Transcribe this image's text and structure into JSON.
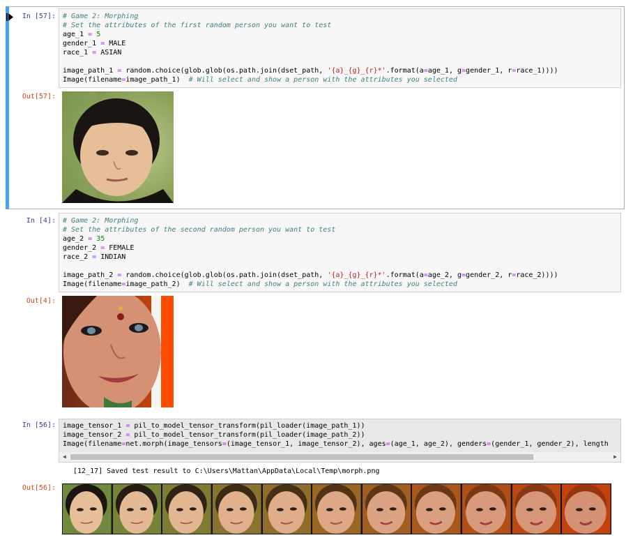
{
  "cells": [
    {
      "in_prompt": "In [57]:",
      "out_prompt": "Out[57]:",
      "code_lines": [
        [
          {
            "t": "# Game 2: Morphing",
            "c": "cm"
          }
        ],
        [
          {
            "t": "# Set the attributes of the first random person you want to test",
            "c": "cm"
          }
        ],
        [
          {
            "t": "age_1 "
          },
          {
            "t": "=",
            "c": "op"
          },
          {
            "t": " "
          },
          {
            "t": "5",
            "c": "nm"
          }
        ],
        [
          {
            "t": "gender_1 "
          },
          {
            "t": "=",
            "c": "op"
          },
          {
            "t": " MALE"
          }
        ],
        [
          {
            "t": "race_1 "
          },
          {
            "t": "=",
            "c": "op"
          },
          {
            "t": " ASIAN"
          }
        ],
        [
          {
            "t": ""
          }
        ],
        [
          {
            "t": "image_path_1 "
          },
          {
            "t": "=",
            "c": "op"
          },
          {
            "t": " random.choice(glob.glob(os.path.join(dset_path, "
          },
          {
            "t": "'{a}_{g}_{r}*'",
            "c": "st"
          },
          {
            "t": ".format(a"
          },
          {
            "t": "=",
            "c": "op"
          },
          {
            "t": "age_1, g"
          },
          {
            "t": "=",
            "c": "op"
          },
          {
            "t": "gender_1, r"
          },
          {
            "t": "=",
            "c": "op"
          },
          {
            "t": "race_1))))"
          }
        ],
        [
          {
            "t": "Image(filename"
          },
          {
            "t": "=",
            "c": "op"
          },
          {
            "t": "image_path_1)  "
          },
          {
            "t": "# Will select and show a person with the attributes you selected",
            "c": "cm"
          }
        ]
      ],
      "image_desc": "child-face"
    },
    {
      "in_prompt": "In [4]:",
      "out_prompt": "Out[4]:",
      "code_lines": [
        [
          {
            "t": "# Game 2: Morphing",
            "c": "cm"
          }
        ],
        [
          {
            "t": "# Set the attributes of the second random person you want to test",
            "c": "cm"
          }
        ],
        [
          {
            "t": "age_2 "
          },
          {
            "t": "=",
            "c": "op"
          },
          {
            "t": " "
          },
          {
            "t": "35",
            "c": "nm"
          }
        ],
        [
          {
            "t": "gender_2 "
          },
          {
            "t": "=",
            "c": "op"
          },
          {
            "t": " FEMALE"
          }
        ],
        [
          {
            "t": "race_2 "
          },
          {
            "t": "=",
            "c": "op"
          },
          {
            "t": " INDIAN"
          }
        ],
        [
          {
            "t": ""
          }
        ],
        [
          {
            "t": "image_path_2 "
          },
          {
            "t": "=",
            "c": "op"
          },
          {
            "t": " random.choice(glob.glob(os.path.join(dset_path, "
          },
          {
            "t": "'{a}_{g}_{r}*'",
            "c": "st"
          },
          {
            "t": ".format(a"
          },
          {
            "t": "=",
            "c": "op"
          },
          {
            "t": "age_2, g"
          },
          {
            "t": "=",
            "c": "op"
          },
          {
            "t": "gender_2, r"
          },
          {
            "t": "=",
            "c": "op"
          },
          {
            "t": "race_2))))"
          }
        ],
        [
          {
            "t": "Image(filename"
          },
          {
            "t": "=",
            "c": "op"
          },
          {
            "t": "image_path_2)  "
          },
          {
            "t": "# Will select and show a person with the attributes you selected",
            "c": "cm"
          }
        ]
      ],
      "image_desc": "woman-face"
    },
    {
      "in_prompt": "In [56]:",
      "out_prompt": "Out[56]:",
      "code_lines": [
        [
          {
            "t": "image_tensor_1 "
          },
          {
            "t": "=",
            "c": "op"
          },
          {
            "t": " pil_to_model_tensor_transform(pil_loader(image_path_1))"
          }
        ],
        [
          {
            "t": "image_tensor_2 "
          },
          {
            "t": "=",
            "c": "op"
          },
          {
            "t": " pil_to_model_tensor_transform(pil_loader(image_path_2))"
          }
        ],
        [
          {
            "t": "Image(filename"
          },
          {
            "t": "=",
            "c": "op"
          },
          {
            "t": "net.morph(image_tensors"
          },
          {
            "t": "=",
            "c": "op"
          },
          {
            "t": "(image_tensor_1, image_tensor_2), ages"
          },
          {
            "t": "=",
            "c": "op"
          },
          {
            "t": "(age_1, age_2), genders"
          },
          {
            "t": "=",
            "c": "op"
          },
          {
            "t": "(gender_1, gender_2), length"
          }
        ]
      ],
      "stdout": "[12_17] Saved test result to C:\\Users\\Mattan\\AppData\\Local\\Temp\\morph.png",
      "morph_frames": 11
    }
  ],
  "colors": {
    "selected_border": "#42a5f5",
    "in_prompt": "#303f9f",
    "out_prompt": "#d84315"
  }
}
